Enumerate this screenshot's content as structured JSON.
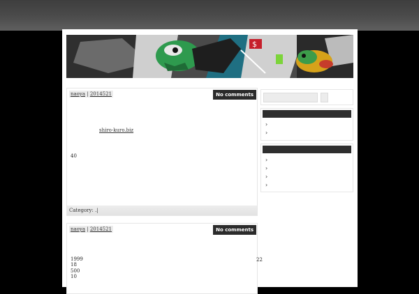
{
  "post1": {
    "author": "naoya",
    "separator": " | ",
    "date": "2014521",
    "comments_label": "No comments",
    "link_text": "shiro-kuro.biz",
    "number": "40",
    "category_label": "Category:  .|"
  },
  "post2": {
    "author": "naoya",
    "separator": " | ",
    "date": "2014521",
    "comments_label": "No comments",
    "lines": [
      "1999",
      "18",
      "500",
      "10"
    ],
    "side_number": "22"
  },
  "sidebar": {
    "widget1_bullets": [
      "›",
      "›"
    ],
    "widget2_bullets": [
      "›",
      "›",
      "›",
      "›"
    ]
  },
  "colors": {
    "banner_green": "#2e9a4e",
    "dark_bar": "#2e2e2e"
  }
}
